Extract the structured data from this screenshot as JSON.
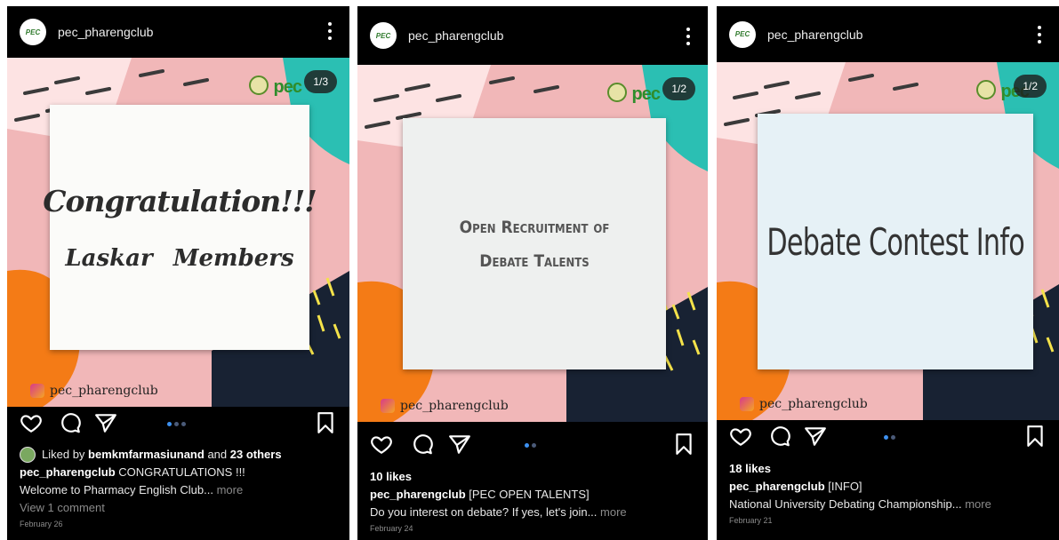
{
  "posts": [
    {
      "username": "pec_pharengclub",
      "avatar_text": "PEC",
      "counter": "1/3",
      "brand": "pec",
      "image_text": [
        "Congratulation!!!",
        "Laskar Members"
      ],
      "watermark": "pec_pharengclub",
      "liked_by_prefix": "Liked by",
      "liked_by_user": "bemkmfarmasiunand",
      "liked_by_suffix": "and",
      "liked_by_others": "23 others",
      "caption_user": "pec_pharengclub",
      "caption_text": "CONGRATULATIONS !!!",
      "caption_line2": "Welcome to Pharmacy English Club...",
      "more": "more",
      "comments": "View 1 comment",
      "date": "February 26"
    },
    {
      "username": "pec_pharengclub",
      "avatar_text": "PEC",
      "counter": "1/2",
      "brand": "pec",
      "image_text": [
        "Open Recruitment of",
        "Debate Talents"
      ],
      "watermark": "pec_pharengclub",
      "likes": "10 likes",
      "caption_user": "pec_pharengclub",
      "caption_text": "[PEC OPEN TALENTS]",
      "caption_line2": "Do you interest on debate? If yes, let's join...",
      "more": "more",
      "date": "February 24"
    },
    {
      "username": "pec_pharengclub",
      "avatar_text": "PEC",
      "counter": "1/2",
      "brand": "pec",
      "image_text": [
        "Debate Contest Info"
      ],
      "watermark": "pec_pharengclub",
      "likes": "18 likes",
      "caption_user": "pec_pharengclub",
      "caption_text": "[INFO]",
      "caption_line2": "National University Debating Championship...",
      "more": "more",
      "date": "February 21"
    }
  ],
  "colors": {
    "background": "#000000",
    "pink": "#f1b7b8",
    "teal": "#2bbfb3",
    "orange": "#f47b16",
    "navy": "#182233",
    "yellow": "#f4e24a",
    "dot_active": "#3d90f0"
  },
  "icons": [
    "heart-icon",
    "comment-icon",
    "share-icon",
    "bookmark-icon",
    "more-options-icon"
  ]
}
